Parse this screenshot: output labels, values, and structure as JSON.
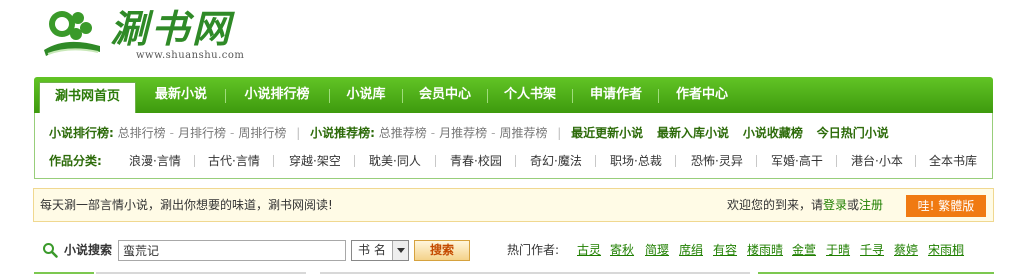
{
  "logo": {
    "text": "涮书网",
    "url": "www.shuanshu.com"
  },
  "nav": {
    "items": [
      {
        "label": "涮书网首页",
        "active": true
      },
      {
        "label": "最新小说"
      },
      {
        "label": "小说排行榜"
      },
      {
        "label": "小说库"
      },
      {
        "label": "会员中心"
      },
      {
        "label": "个人书架"
      },
      {
        "label": "申请作者"
      },
      {
        "label": "作者中心"
      }
    ]
  },
  "ranking": {
    "title": "小说排行榜:",
    "items": [
      "总排行榜",
      "月排行榜",
      "周排行榜"
    ],
    "rec_title": "小说推荐榜:",
    "rec_items": [
      "总推荐榜",
      "月推荐榜",
      "周推荐榜"
    ],
    "links": [
      "最近更新小说",
      "最新入库小说",
      "小说收藏榜",
      "今日热门小说"
    ]
  },
  "categories": {
    "title": "作品分类:",
    "items": [
      "浪漫·言情",
      "古代·言情",
      "穿越·架空",
      "耽美·同人",
      "青春·校园",
      "奇幻·魔法",
      "职场·总裁",
      "恐怖·灵异",
      "军婚·高干",
      "港台·小本",
      "全本书库"
    ]
  },
  "notice": {
    "text": "每天涮一部言情小说，涮出你想要的味道，涮书网阅读!",
    "welcome_prefix": "欢迎您的到来，请",
    "login": "登录",
    "or": "或",
    "register": "注册",
    "traditional_button": "哇! 繁體版"
  },
  "search": {
    "label": "小说搜索",
    "value": "蛮荒记",
    "select_value": "书 名",
    "button": "搜索",
    "hot_label": "热门作者:",
    "hot_authors": [
      "古灵",
      "寄秋",
      "简璎",
      "席绢",
      "有容",
      "楼雨晴",
      "金萱",
      "于晴",
      "千寻",
      "蔡婷",
      "宋雨桐"
    ]
  }
}
